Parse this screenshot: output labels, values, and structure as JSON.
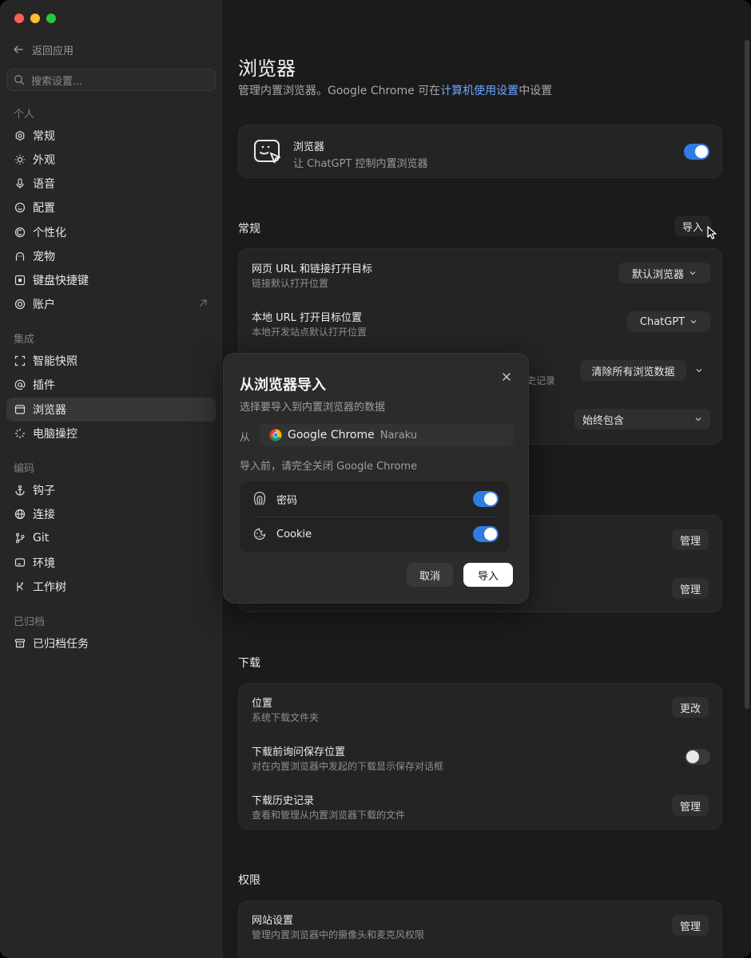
{
  "sidebar": {
    "back_label": "返回应用",
    "search_placeholder": "搜索设置...",
    "sections": [
      {
        "title": "个人",
        "items": [
          {
            "label": "常规",
            "icon": "gear-icon"
          },
          {
            "label": "外观",
            "icon": "sun-icon"
          },
          {
            "label": "语音",
            "icon": "microphone-icon"
          },
          {
            "label": "配置",
            "icon": "config-icon"
          },
          {
            "label": "个性化",
            "icon": "personalize-icon"
          },
          {
            "label": "宠物",
            "icon": "pet-icon"
          },
          {
            "label": "键盘快捷键",
            "icon": "keyboard-icon"
          },
          {
            "label": "账户",
            "icon": "account-icon"
          }
        ]
      },
      {
        "title": "集成",
        "items": [
          {
            "label": "智能快照",
            "icon": "snapshot-icon"
          },
          {
            "label": "插件",
            "icon": "at-icon"
          },
          {
            "label": "浏览器",
            "icon": "browser-icon"
          },
          {
            "label": "电脑操控",
            "icon": "computer-control-icon"
          }
        ]
      },
      {
        "title": "编码",
        "items": [
          {
            "label": "钩子",
            "icon": "anchor-icon"
          },
          {
            "label": "连接",
            "icon": "globe-icon"
          },
          {
            "label": "Git",
            "icon": "git-icon"
          },
          {
            "label": "环境",
            "icon": "environment-icon"
          },
          {
            "label": "工作树",
            "icon": "worktree-icon"
          }
        ]
      },
      {
        "title": "已归档",
        "items": [
          {
            "label": "已归档任务",
            "icon": "archive-icon"
          }
        ]
      }
    ],
    "active": "浏览器"
  },
  "main": {
    "title": "浏览器",
    "subtitle_prefix": "管理内置浏览器。Google Chrome 可在",
    "subtitle_link": "计算机使用设置",
    "subtitle_suffix": "中设置",
    "browser_card": {
      "title": "浏览器",
      "desc": "让 ChatGPT 控制内置浏览器",
      "enabled": true
    },
    "general": {
      "heading": "常规",
      "import_label": "导入",
      "rows": [
        {
          "title": "网页 URL 和链接打开目标",
          "desc": "链接默认打开位置",
          "control": "默认浏览器"
        },
        {
          "title": "本地 URL 打开目标位置",
          "desc": "本地开发站点默认打开位置",
          "control": "ChatGPT"
        },
        {
          "title": "",
          "desc": "史记录",
          "control": "清除所有浏览数据"
        },
        {
          "title": "",
          "desc": "",
          "control": "始终包含"
        }
      ]
    },
    "hidden_manage": [
      "管理",
      "管理"
    ],
    "downloads": {
      "heading": "下载",
      "rows": [
        {
          "title": "位置",
          "desc": "系统下载文件夹",
          "control": "更改"
        },
        {
          "title": "下载前询问保存位置",
          "desc": "对在内置浏览器中发起的下载显示保存对话框",
          "toggle": false
        },
        {
          "title": "下载历史记录",
          "desc": "查看和管理从内置浏览器下载的文件",
          "control": "管理"
        }
      ]
    },
    "permissions": {
      "heading": "权限",
      "rows": [
        {
          "title": "网站设置",
          "desc": "管理内置浏览器中的摄像头和麦克风权限",
          "control": "管理"
        }
      ]
    }
  },
  "dialog": {
    "title": "从浏览器导入",
    "subtitle": "选择要导入到内置浏览器的数据",
    "from_label": "从",
    "source_browser": "Google Chrome",
    "source_profile": "Naraku",
    "note": "导入前，请完全关闭 Google Chrome",
    "options": [
      {
        "label": "密码",
        "icon": "password-icon",
        "enabled": true
      },
      {
        "label": "Cookie",
        "icon": "cookie-icon",
        "enabled": true
      }
    ],
    "cancel_label": "取消",
    "import_label": "导入"
  }
}
